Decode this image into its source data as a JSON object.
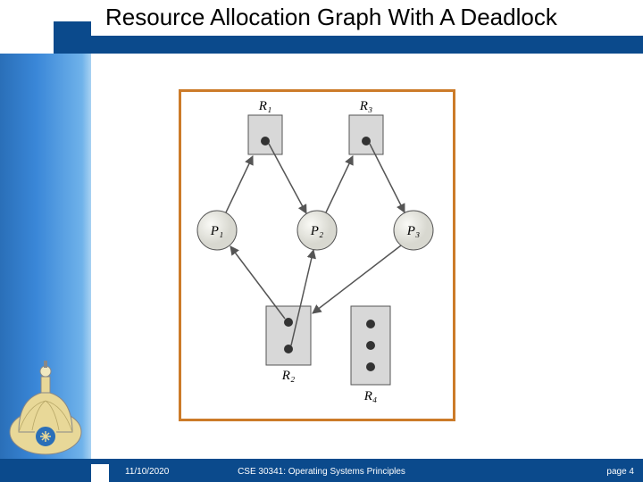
{
  "title": "Resource Allocation Graph With A Deadlock",
  "footer": {
    "date": "11/10/2020",
    "course": "CSE 30341: Operating Systems Principles",
    "page": "page 4"
  },
  "diagram": {
    "processes": {
      "P1": "P₁",
      "P2": "P₂",
      "P3": "P₃"
    },
    "resources": {
      "R1": "R₁",
      "R2": "R₂",
      "R3": "R₃",
      "R4": "R₄"
    }
  }
}
